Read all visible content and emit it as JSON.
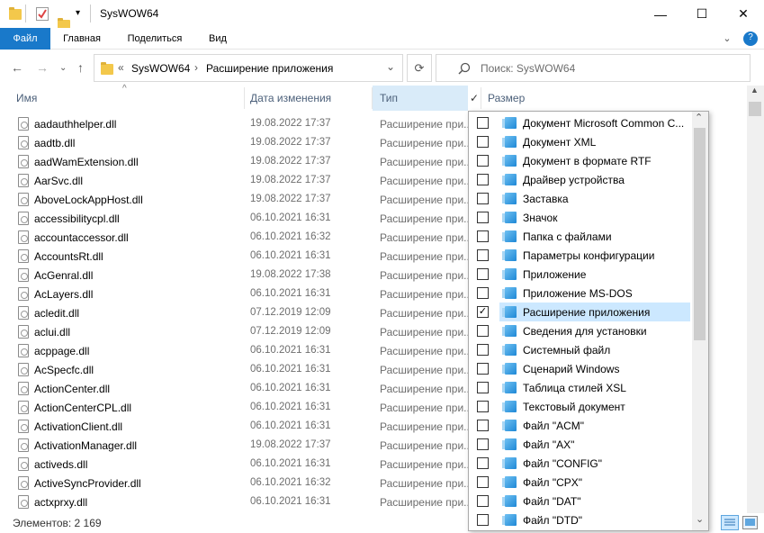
{
  "window": {
    "title": "SysWOW64",
    "minimize_glyph": "—",
    "maximize_glyph": "☐",
    "close_glyph": "✕"
  },
  "ribbon": {
    "tabs": [
      "Файл",
      "Главная",
      "Поделиться",
      "Вид"
    ],
    "expand_glyph": "⌄",
    "help_glyph": "?"
  },
  "address": {
    "overflow": "«",
    "crumbs": [
      "SysWOW64",
      "Расширение приложения"
    ],
    "separator": "›",
    "dropdown": "⌄",
    "refresh": "⟳",
    "search_placeholder": "Поиск: SysWOW64"
  },
  "columns": {
    "name": "Имя",
    "date": "Дата изменения",
    "type": "Тип",
    "size": "Размер",
    "sort_glyph": "^",
    "filter_check": "✓"
  },
  "files": [
    {
      "name": "aadauthhelper.dll",
      "date": "19.08.2022 17:37",
      "type": "Расширение при..."
    },
    {
      "name": "aadtb.dll",
      "date": "19.08.2022 17:37",
      "type": "Расширение при..."
    },
    {
      "name": "aadWamExtension.dll",
      "date": "19.08.2022 17:37",
      "type": "Расширение при..."
    },
    {
      "name": "AarSvc.dll",
      "date": "19.08.2022 17:37",
      "type": "Расширение при..."
    },
    {
      "name": "AboveLockAppHost.dll",
      "date": "19.08.2022 17:37",
      "type": "Расширение при..."
    },
    {
      "name": "accessibilitycpl.dll",
      "date": "06.10.2021 16:31",
      "type": "Расширение при..."
    },
    {
      "name": "accountaccessor.dll",
      "date": "06.10.2021 16:32",
      "type": "Расширение при..."
    },
    {
      "name": "AccountsRt.dll",
      "date": "06.10.2021 16:31",
      "type": "Расширение при..."
    },
    {
      "name": "AcGenral.dll",
      "date": "19.08.2022 17:38",
      "type": "Расширение при..."
    },
    {
      "name": "AcLayers.dll",
      "date": "06.10.2021 16:31",
      "type": "Расширение при..."
    },
    {
      "name": "acledit.dll",
      "date": "07.12.2019 12:09",
      "type": "Расширение при..."
    },
    {
      "name": "aclui.dll",
      "date": "07.12.2019 12:09",
      "type": "Расширение при..."
    },
    {
      "name": "acppage.dll",
      "date": "06.10.2021 16:31",
      "type": "Расширение при..."
    },
    {
      "name": "AcSpecfc.dll",
      "date": "06.10.2021 16:31",
      "type": "Расширение при..."
    },
    {
      "name": "ActionCenter.dll",
      "date": "06.10.2021 16:31",
      "type": "Расширение при..."
    },
    {
      "name": "ActionCenterCPL.dll",
      "date": "06.10.2021 16:31",
      "type": "Расширение при..."
    },
    {
      "name": "ActivationClient.dll",
      "date": "06.10.2021 16:31",
      "type": "Расширение при..."
    },
    {
      "name": "ActivationManager.dll",
      "date": "19.08.2022 17:37",
      "type": "Расширение при..."
    },
    {
      "name": "activeds.dll",
      "date": "06.10.2021 16:31",
      "type": "Расширение при..."
    },
    {
      "name": "ActiveSyncProvider.dll",
      "date": "06.10.2021 16:32",
      "type": "Расширение при..."
    },
    {
      "name": "actxprxy.dll",
      "date": "06.10.2021 16:31",
      "type": "Расширение при..."
    }
  ],
  "type_filter": {
    "scroll_up": "⌃",
    "scroll_down": "⌄",
    "options": [
      {
        "label": "Документ Microsoft Common C...",
        "checked": false
      },
      {
        "label": "Документ XML",
        "checked": false
      },
      {
        "label": "Документ в формате RTF",
        "checked": false
      },
      {
        "label": "Драйвер устройства",
        "checked": false
      },
      {
        "label": "Заставка",
        "checked": false
      },
      {
        "label": "Значок",
        "checked": false
      },
      {
        "label": "Папка с файлами",
        "checked": false
      },
      {
        "label": "Параметры конфигурации",
        "checked": false
      },
      {
        "label": "Приложение",
        "checked": false
      },
      {
        "label": "Приложение MS-DOS",
        "checked": false
      },
      {
        "label": "Расширение приложения",
        "checked": true
      },
      {
        "label": "Сведения для установки",
        "checked": false
      },
      {
        "label": "Системный файл",
        "checked": false
      },
      {
        "label": "Сценарий Windows",
        "checked": false
      },
      {
        "label": "Таблица стилей XSL",
        "checked": false
      },
      {
        "label": "Текстовый документ",
        "checked": false
      },
      {
        "label": "Файл \"ACM\"",
        "checked": false
      },
      {
        "label": "Файл \"AX\"",
        "checked": false
      },
      {
        "label": "Файл \"CONFIG\"",
        "checked": false
      },
      {
        "label": "Файл \"CPX\"",
        "checked": false
      },
      {
        "label": "Файл \"DAT\"",
        "checked": false
      },
      {
        "label": "Файл \"DTD\"",
        "checked": false
      }
    ]
  },
  "status": {
    "item_count": "Элементов: 2 169"
  },
  "colors": {
    "accent": "#1979ca",
    "selected_bg": "#cce8ff",
    "header_text": "#4c607a"
  },
  "icons": {
    "qa_folder": "folder-icon",
    "qa_properties": "properties-icon",
    "qa_new_folder": "new-folder-icon",
    "customize": "customize-arrow-icon",
    "back": "back-arrow-icon",
    "forward": "forward-arrow-icon",
    "recent": "recent-dropdown-icon",
    "up": "up-arrow-icon",
    "refresh": "refresh-icon",
    "search": "search-icon",
    "file": "dll-file-icon",
    "type": "file-type-icon",
    "view_details": "details-view-icon",
    "view_large": "large-icons-view-icon"
  }
}
